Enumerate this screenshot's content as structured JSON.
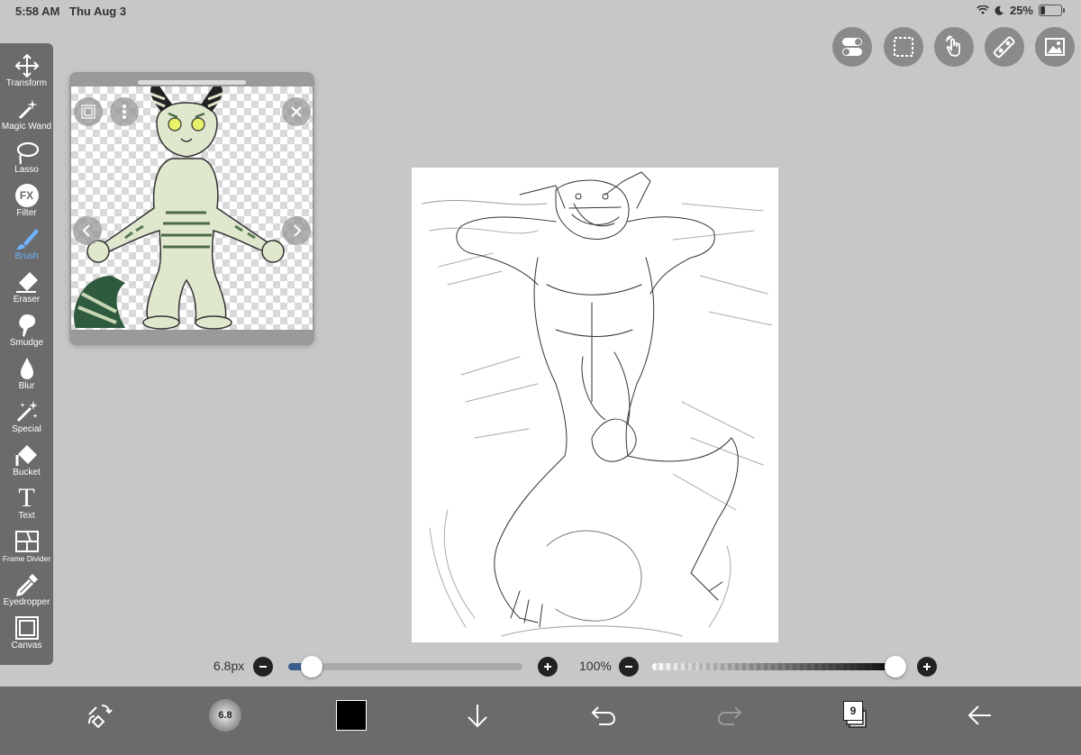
{
  "status": {
    "time": "5:58 AM",
    "date": "Thu Aug 3",
    "battery": "25%"
  },
  "tools": [
    {
      "label": "Transform",
      "icon": "move-arrows-icon"
    },
    {
      "label": "Magic Wand",
      "icon": "magic-wand-icon"
    },
    {
      "label": "Lasso",
      "icon": "lasso-icon"
    },
    {
      "label": "Filter",
      "icon": "fx-icon",
      "glyph": "FX"
    },
    {
      "label": "Brush",
      "icon": "brush-icon",
      "active": true
    },
    {
      "label": "Eraser",
      "icon": "eraser-icon"
    },
    {
      "label": "Smudge",
      "icon": "smudge-icon"
    },
    {
      "label": "Blur",
      "icon": "blur-drop-icon"
    },
    {
      "label": "Special",
      "icon": "special-wand-icon"
    },
    {
      "label": "Bucket",
      "icon": "bucket-icon"
    },
    {
      "label": "Text",
      "icon": "text-icon",
      "glyph": "T"
    },
    {
      "label": "Frame Divider",
      "icon": "frame-divider-icon"
    },
    {
      "label": "Eyedropper",
      "icon": "eyedropper-icon"
    },
    {
      "label": "Canvas",
      "icon": "canvas-icon"
    }
  ],
  "top_buttons": [
    "toggle-icon",
    "selection-icon",
    "touch-hand-icon",
    "ruler-icon",
    "gallery-icon"
  ],
  "brush": {
    "size_label": "6.8px",
    "size_fraction": 0.1,
    "thumb_label": "6.8"
  },
  "opacity": {
    "label": "100%",
    "fraction": 1.0
  },
  "color": {
    "current": "#000000",
    "accent": "#3478f6"
  },
  "layers": {
    "count": "9"
  }
}
